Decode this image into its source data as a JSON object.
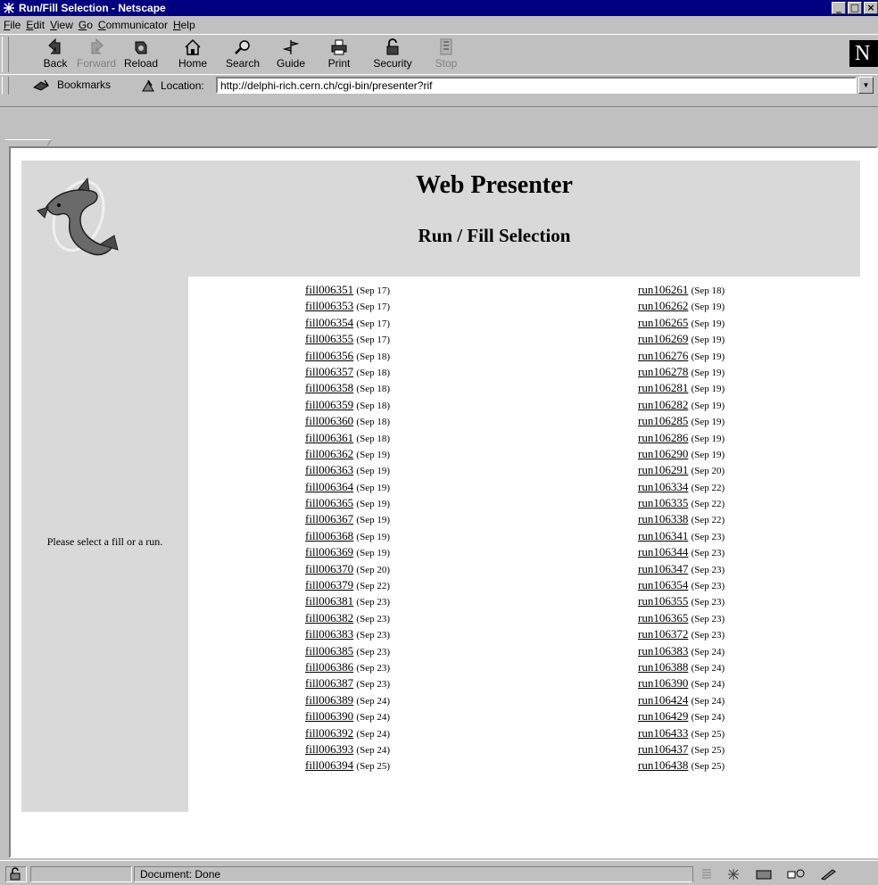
{
  "window": {
    "title": "Run/Fill Selection - Netscape",
    "buttons": [
      "_",
      "□",
      "×"
    ]
  },
  "menu": [
    "File",
    "Edit",
    "View",
    "Go",
    "Communicator",
    "Help"
  ],
  "toolbar": {
    "buttons": [
      {
        "label": "Back",
        "icon": "back-arrow-icon",
        "enabled": true
      },
      {
        "label": "Forward",
        "icon": "forward-arrow-icon",
        "enabled": false
      },
      {
        "label": "Reload",
        "icon": "reload-icon",
        "enabled": true
      },
      {
        "label": "Home",
        "icon": "home-icon",
        "enabled": true
      },
      {
        "label": "Search",
        "icon": "search-icon",
        "enabled": true
      },
      {
        "label": "Guide",
        "icon": "guide-icon",
        "enabled": true
      },
      {
        "label": "Print",
        "icon": "print-icon",
        "enabled": true
      },
      {
        "label": "Security",
        "icon": "lock-icon",
        "enabled": true
      },
      {
        "label": "Stop",
        "icon": "stop-icon",
        "enabled": false
      }
    ],
    "logo_letter": "N"
  },
  "location": {
    "bookmarks_label": "Bookmarks",
    "label": "Location:",
    "url": "http://delphi-rich.cern.ch/cgi-bin/presenter?rif"
  },
  "page": {
    "title": "Web Presenter",
    "subtitle": "Run / Fill Selection",
    "prompt": "Please select a fill or a run.",
    "fills": [
      {
        "id": "fill006351",
        "date": "(Sep 17)"
      },
      {
        "id": "fill006353",
        "date": "(Sep 17)"
      },
      {
        "id": "fill006354",
        "date": "(Sep 17)"
      },
      {
        "id": "fill006355",
        "date": "(Sep 17)"
      },
      {
        "id": "fill006356",
        "date": "(Sep 18)"
      },
      {
        "id": "fill006357",
        "date": "(Sep 18)"
      },
      {
        "id": "fill006358",
        "date": "(Sep 18)"
      },
      {
        "id": "fill006359",
        "date": "(Sep 18)"
      },
      {
        "id": "fill006360",
        "date": "(Sep 18)"
      },
      {
        "id": "fill006361",
        "date": "(Sep 18)"
      },
      {
        "id": "fill006362",
        "date": "(Sep 19)"
      },
      {
        "id": "fill006363",
        "date": "(Sep 19)"
      },
      {
        "id": "fill006364",
        "date": "(Sep 19)"
      },
      {
        "id": "fill006365",
        "date": "(Sep 19)"
      },
      {
        "id": "fill006367",
        "date": "(Sep 19)"
      },
      {
        "id": "fill006368",
        "date": "(Sep 19)"
      },
      {
        "id": "fill006369",
        "date": "(Sep 19)"
      },
      {
        "id": "fill006370",
        "date": "(Sep 20)"
      },
      {
        "id": "fill006379",
        "date": "(Sep 22)"
      },
      {
        "id": "fill006381",
        "date": "(Sep 23)"
      },
      {
        "id": "fill006382",
        "date": "(Sep 23)"
      },
      {
        "id": "fill006383",
        "date": "(Sep 23)"
      },
      {
        "id": "fill006385",
        "date": "(Sep 23)"
      },
      {
        "id": "fill006386",
        "date": "(Sep 23)"
      },
      {
        "id": "fill006387",
        "date": "(Sep 23)"
      },
      {
        "id": "fill006389",
        "date": "(Sep 24)"
      },
      {
        "id": "fill006390",
        "date": "(Sep 24)"
      },
      {
        "id": "fill006392",
        "date": "(Sep 24)"
      },
      {
        "id": "fill006393",
        "date": "(Sep 24)"
      },
      {
        "id": "fill006394",
        "date": "(Sep 25)"
      }
    ],
    "runs": [
      {
        "id": "run106261",
        "date": "(Sep 18)"
      },
      {
        "id": "run106262",
        "date": "(Sep 19)"
      },
      {
        "id": "run106265",
        "date": "(Sep 19)"
      },
      {
        "id": "run106269",
        "date": "(Sep 19)"
      },
      {
        "id": "run106276",
        "date": "(Sep 19)"
      },
      {
        "id": "run106278",
        "date": "(Sep 19)"
      },
      {
        "id": "run106281",
        "date": "(Sep 19)"
      },
      {
        "id": "run106282",
        "date": "(Sep 19)"
      },
      {
        "id": "run106285",
        "date": "(Sep 19)"
      },
      {
        "id": "run106286",
        "date": "(Sep 19)"
      },
      {
        "id": "run106290",
        "date": "(Sep 19)"
      },
      {
        "id": "run106291",
        "date": "(Sep 20)"
      },
      {
        "id": "run106334",
        "date": "(Sep 22)"
      },
      {
        "id": "run106335",
        "date": "(Sep 22)"
      },
      {
        "id": "run106338",
        "date": "(Sep 22)"
      },
      {
        "id": "run106341",
        "date": "(Sep 23)"
      },
      {
        "id": "run106344",
        "date": "(Sep 23)"
      },
      {
        "id": "run106347",
        "date": "(Sep 23)"
      },
      {
        "id": "run106354",
        "date": "(Sep 23)"
      },
      {
        "id": "run106355",
        "date": "(Sep 23)"
      },
      {
        "id": "run106365",
        "date": "(Sep 23)"
      },
      {
        "id": "run106372",
        "date": "(Sep 23)"
      },
      {
        "id": "run106383",
        "date": "(Sep 24)"
      },
      {
        "id": "run106388",
        "date": "(Sep 24)"
      },
      {
        "id": "run106390",
        "date": "(Sep 24)"
      },
      {
        "id": "run106424",
        "date": "(Sep 24)"
      },
      {
        "id": "run106429",
        "date": "(Sep 24)"
      },
      {
        "id": "run106433",
        "date": "(Sep 25)"
      },
      {
        "id": "run106437",
        "date": "(Sep 25)"
      },
      {
        "id": "run106438",
        "date": "(Sep 25)"
      }
    ]
  },
  "status": {
    "text": "Document: Done"
  },
  "colors": {
    "titlebar": "#000080",
    "chrome": "#c0c0c0",
    "banner": "#d9d9d9"
  }
}
